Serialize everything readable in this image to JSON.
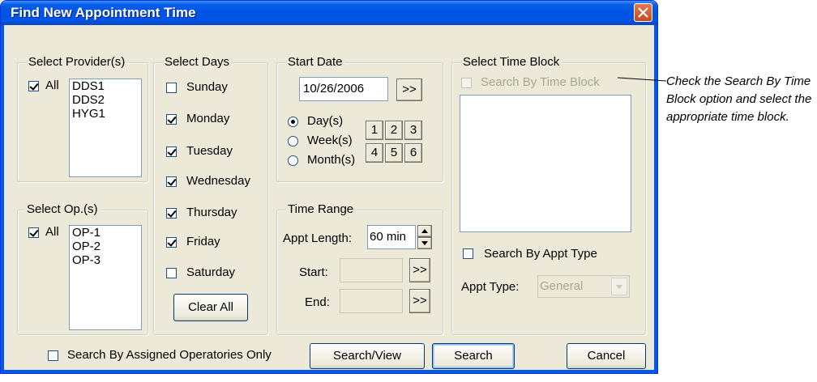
{
  "window": {
    "title": "Find New Appointment Time"
  },
  "providers": {
    "group_title": "Select Provider(s)",
    "all_label": "All",
    "all_checked": true,
    "items": [
      "DDS1",
      "DDS2",
      "HYG1"
    ]
  },
  "ops": {
    "group_title": "Select Op.(s)",
    "all_label": "All",
    "all_checked": true,
    "items": [
      "OP-1",
      "OP-2",
      "OP-3"
    ]
  },
  "days": {
    "group_title": "Select Days",
    "items": [
      {
        "label": "Sunday",
        "checked": false
      },
      {
        "label": "Monday",
        "checked": true
      },
      {
        "label": "Tuesday",
        "checked": true
      },
      {
        "label": "Wednesday",
        "checked": true
      },
      {
        "label": "Thursday",
        "checked": true
      },
      {
        "label": "Friday",
        "checked": true
      },
      {
        "label": "Saturday",
        "checked": false
      }
    ],
    "clear_all_label": "Clear All"
  },
  "start_date": {
    "group_title": "Start Date",
    "value": "10/26/2006",
    "browse_label": ">>",
    "units": [
      {
        "label": "Day(s)",
        "selected": true
      },
      {
        "label": "Week(s)",
        "selected": false
      },
      {
        "label": "Month(s)",
        "selected": false
      }
    ],
    "numbers": [
      "1",
      "2",
      "3",
      "4",
      "5",
      "6"
    ]
  },
  "time_range": {
    "group_title": "Time Range",
    "appt_length_label": "Appt Length:",
    "appt_length_value": "60 min",
    "start_label": "Start:",
    "end_label": "End:",
    "browse_label": ">>"
  },
  "time_block": {
    "group_title": "Select Time Block",
    "search_by_block_label": "Search By Time Block",
    "search_by_block_checked": false,
    "search_by_appt_type_label": "Search By Appt Type",
    "search_by_appt_type_checked": false,
    "appt_type_label": "Appt Type:",
    "appt_type_value": "General"
  },
  "footer": {
    "assigned_ops_label": "Search By Assigned Operatories Only",
    "assigned_ops_checked": false,
    "search_view_label": "Search/View",
    "search_label": "Search",
    "cancel_label": "Cancel"
  },
  "callout": {
    "text": "Check the Search By Time Block option and select the appropriate time block."
  }
}
